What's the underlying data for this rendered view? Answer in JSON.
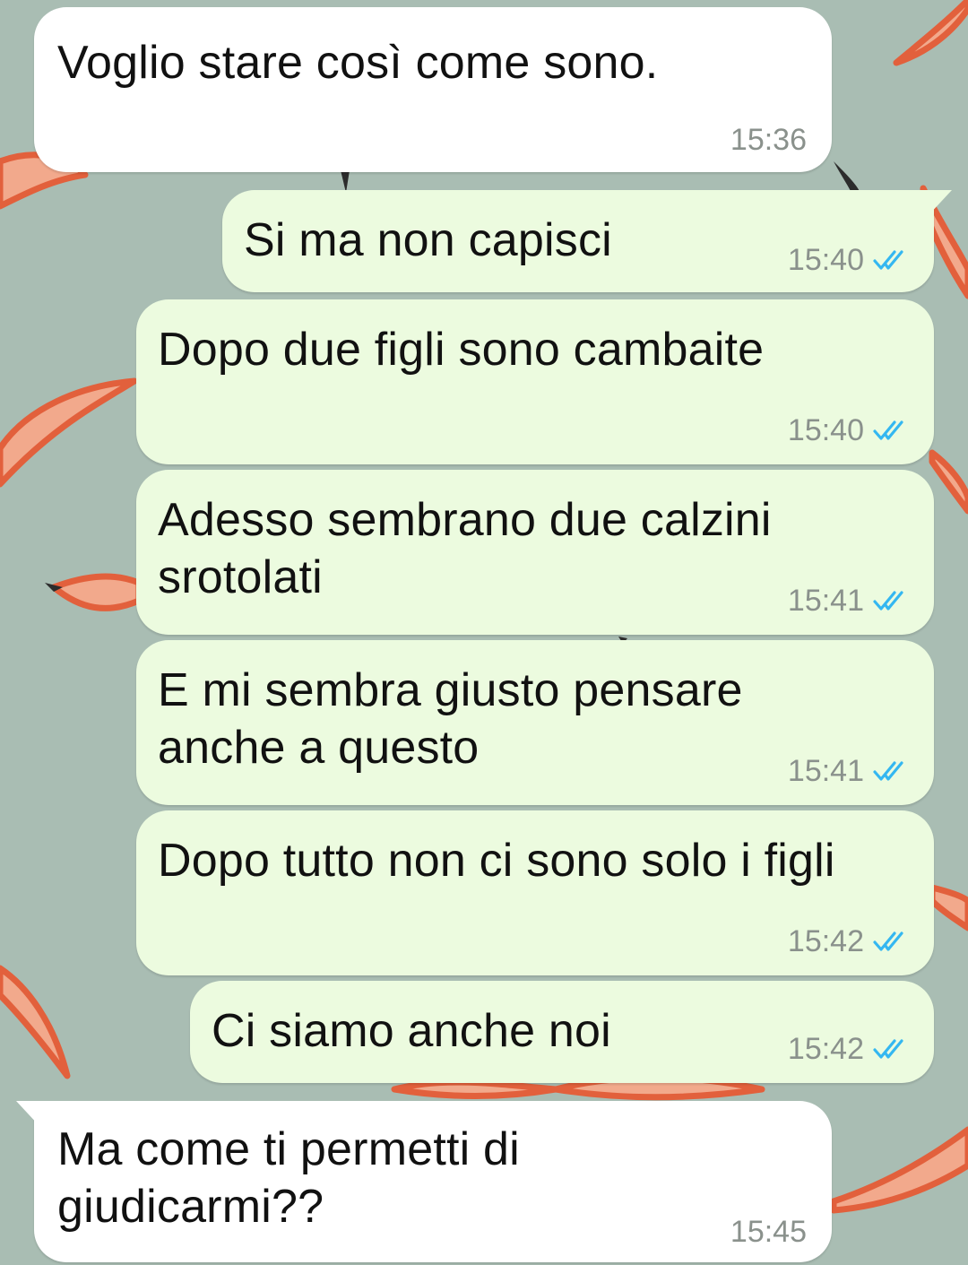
{
  "colors": {
    "incoming_bubble": "#ffffff",
    "outgoing_bubble": "#ecfbdf",
    "wallpaper": "#a9bdb3",
    "timestamp": "#8a918c",
    "read_ticks": "#34b7f1"
  },
  "messages": [
    {
      "direction": "incoming",
      "text": "Voglio stare così come sono.",
      "time": "15:36"
    },
    {
      "direction": "outgoing",
      "text": "Si ma non capisci",
      "time": "15:40",
      "status": "read"
    },
    {
      "direction": "outgoing",
      "text": "Dopo due figli sono cambaite",
      "time": "15:40",
      "status": "read"
    },
    {
      "direction": "outgoing",
      "text": "Adesso sembrano due calzini\nsrotolati",
      "time": "15:41",
      "status": "read"
    },
    {
      "direction": "outgoing",
      "text": "E mi sembra giusto pensare\nanche a questo",
      "time": "15:41",
      "status": "read"
    },
    {
      "direction": "outgoing",
      "text": "Dopo tutto non ci sono solo i figli",
      "time": "15:42",
      "status": "read"
    },
    {
      "direction": "outgoing",
      "text": "Ci siamo anche noi",
      "time": "15:42",
      "status": "read"
    },
    {
      "direction": "incoming",
      "text": "Ma come ti permetti di\ngiudicarmi??",
      "time": "15:45"
    }
  ]
}
